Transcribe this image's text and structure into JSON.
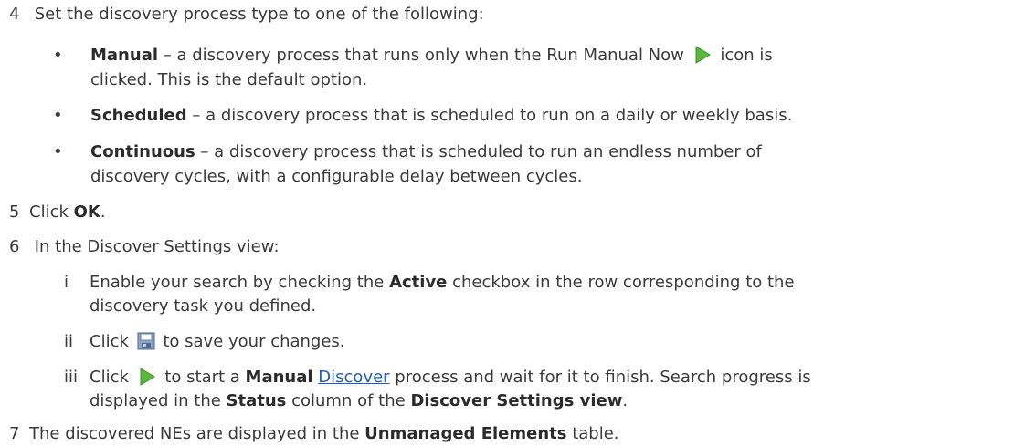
{
  "steps": {
    "s4": {
      "num": "4",
      "text": "Set the discovery process type to one of the following:"
    },
    "manual": {
      "term": "Manual",
      "text1": " – a discovery process that runs only when the Run Manual Now ",
      "text2": " icon is",
      "line2": "clicked. This is the default option."
    },
    "scheduled": {
      "term": "Scheduled",
      "text": " – a discovery process that is scheduled to run on a daily or weekly basis."
    },
    "continuous": {
      "term": "Continuous",
      "text": " – a discovery process that is scheduled to run an endless number of",
      "line2": "discovery cycles, with a configurable delay between cycles."
    },
    "s5": {
      "num": "5",
      "pre": "Click ",
      "ok": "OK",
      "post": "."
    },
    "s6": {
      "num": "6",
      "text": "In the Discover Settings view:"
    },
    "i": {
      "num": "i",
      "pre": "Enable your search by checking the ",
      "active": "Active",
      "post": " checkbox in the row corresponding to the",
      "line2": "discovery task you defined."
    },
    "ii": {
      "num": "ii",
      "pre": "Click ",
      "post": " to save your changes."
    },
    "iii": {
      "num": "iii",
      "pre": "Click ",
      "mid": " to start a ",
      "manual": "Manual",
      "link": "Discover",
      "post": " process and wait for it to finish. Search progress is",
      "line2a": "displayed in the ",
      "status": "Status",
      "line2b": " column of the ",
      "dsv": "Discover Settings view",
      "line2c": "."
    },
    "s7": {
      "num": "7",
      "pre": "The discovered NEs are displayed in the ",
      "ume": "Unmanaged Elements",
      "post": " table."
    }
  },
  "bullet": "•",
  "icons": {
    "run": "play-icon",
    "save": "save-icon"
  },
  "colors": {
    "text": "#3a3a3a",
    "link": "#1f5fbf",
    "play": "#5cb83c"
  }
}
